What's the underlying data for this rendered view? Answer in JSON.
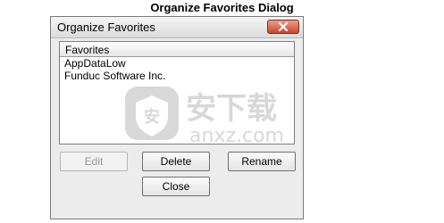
{
  "caption": "Organize Favorites Dialog",
  "dialog": {
    "title": "Organize Favorites",
    "close_icon": "close-x-icon",
    "list": {
      "header": "Favorites",
      "items": [
        "AppDataLow",
        "Funduc Software Inc."
      ]
    },
    "buttons": {
      "edit": "Edit",
      "delete": "Delete",
      "rename": "Rename",
      "close": "Close"
    }
  },
  "watermark": "anxz.com",
  "colors": {
    "close_button": "#c9452c",
    "dialog_bg": "#ececec"
  }
}
